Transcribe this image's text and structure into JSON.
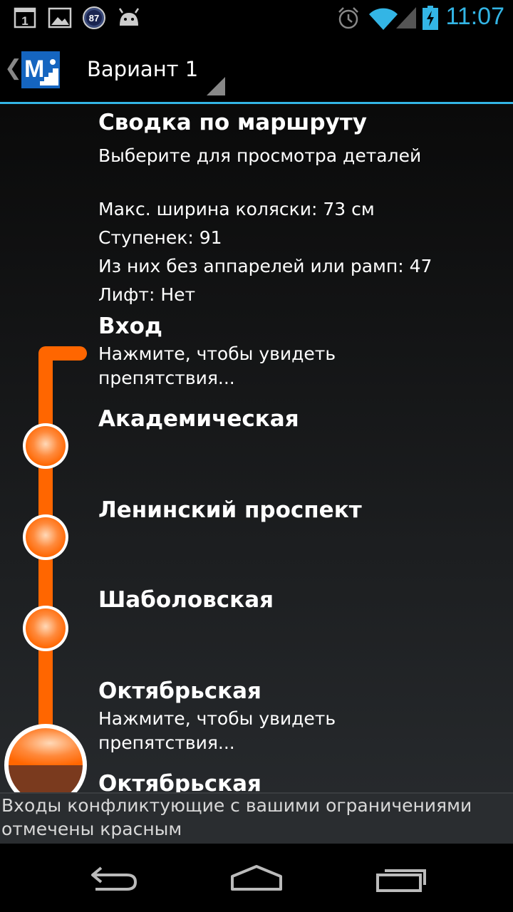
{
  "status_bar": {
    "time": "11:07",
    "notification_badge": "87",
    "icons": [
      "calendar-icon",
      "image-icon",
      "badge-icon",
      "android-icon",
      "alarm-icon",
      "wifi-icon",
      "signal-icon",
      "battery-icon"
    ]
  },
  "action_bar": {
    "app_logo_letter": "M",
    "spinner_value": "Вариант 1"
  },
  "summary": {
    "title": "Сводка по маршруту",
    "subtitle": "Выберите для просмотра деталей",
    "max_width": "Макс. ширина коляски: 73 см",
    "steps": "Ступенек: 91",
    "without_rails": "Из них без аппарелей или рамп: 47",
    "elevator": "Лифт: Нет"
  },
  "route": {
    "entrance_title": "Вход",
    "entrance_hint_1": "Нажмите, чтобы увидеть",
    "entrance_hint_2": "препятствия...",
    "stations": [
      "Академическая",
      "Ленинский проспект",
      "Шаболовская"
    ],
    "transfer_title": "Октябрьская",
    "transfer_hint_1": "Нажмите, чтобы увидеть",
    "transfer_hint_2": "препятствия...",
    "next_title": "Октябрьская",
    "line_color": "#ff6600",
    "transfer_lower_color": "#7a3a1e"
  },
  "note": {
    "line1": "Входы конфликтующие с вашими ограничениями",
    "line2": "отмечены красным"
  },
  "nav_bar": {
    "icons": [
      "back-icon",
      "home-icon",
      "recent-apps-icon"
    ]
  }
}
